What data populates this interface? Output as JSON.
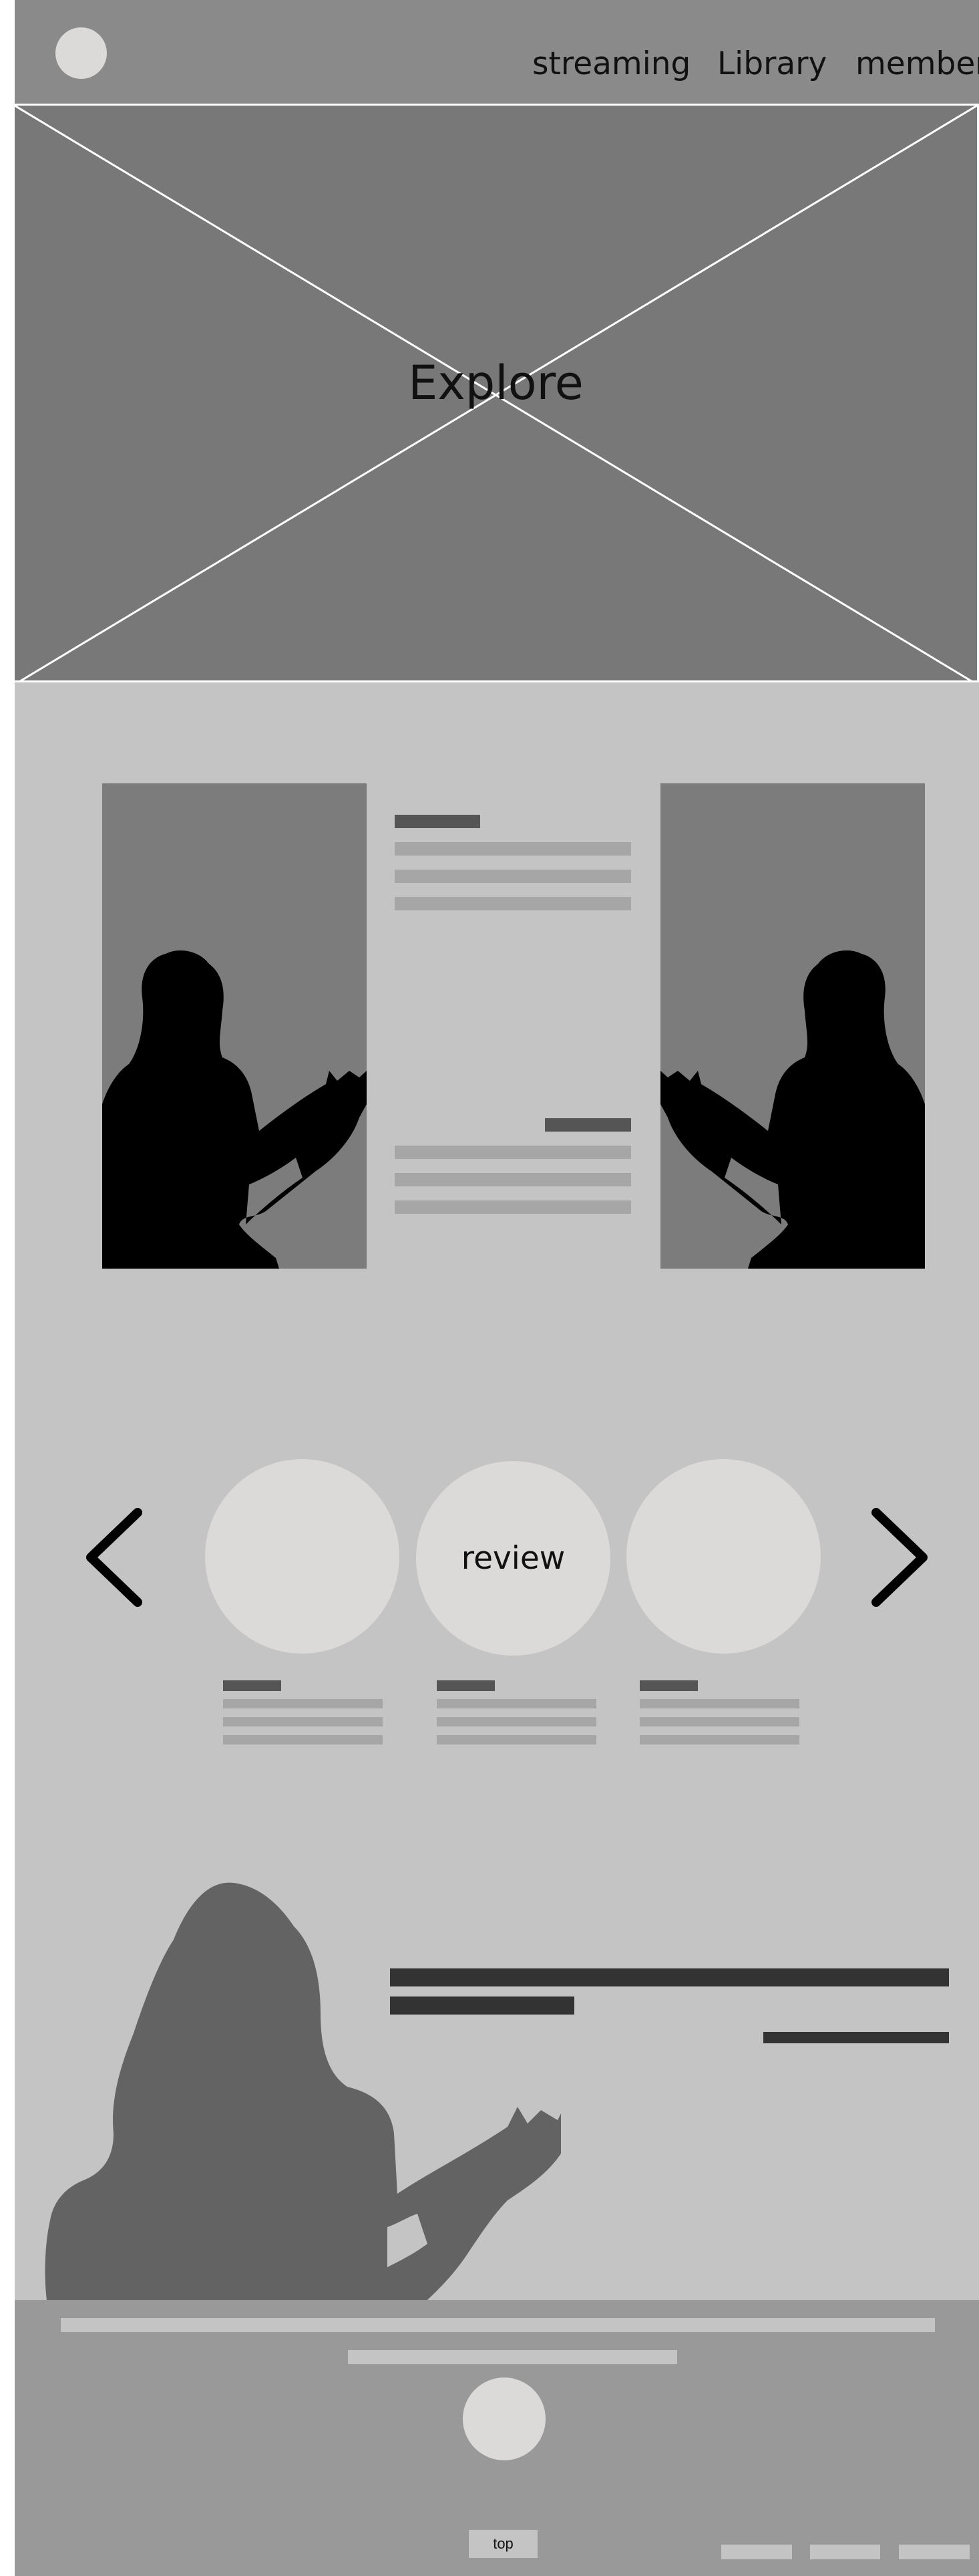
{
  "header": {
    "nav": [
      {
        "label": "streaming"
      },
      {
        "label": "Library"
      },
      {
        "label": "member"
      }
    ]
  },
  "hero": {
    "title": "Explore"
  },
  "carousel": {
    "center_label": "review",
    "prev_icon": "chevron-left-icon",
    "next_icon": "chevron-right-icon"
  },
  "footer": {
    "top_label": "top"
  },
  "colors": {
    "header_bg": "#8a8a8a",
    "hero_bg": "#787878",
    "main_bg": "#c4c4c4",
    "footer_bg": "#999999",
    "circle_fill": "#dcd9d9"
  }
}
